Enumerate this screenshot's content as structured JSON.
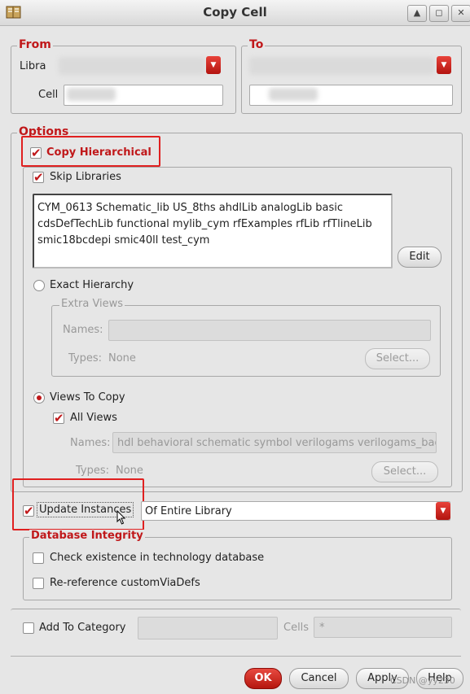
{
  "window": {
    "title": "Copy Cell"
  },
  "from": {
    "title": "From",
    "library_label": "Libra",
    "cell_label": "Cell"
  },
  "to": {
    "title": "To"
  },
  "options": {
    "title": "Options",
    "copy_hierarchical": {
      "label": "Copy Hierarchical",
      "checked": true
    },
    "skip_libraries": {
      "label": "Skip Libraries",
      "checked": true,
      "list": "CYM_0613 Schematic_lib US_8ths ahdlLib analogLib basic cdsDefTechLib functional mylib_cym rfExamples rfLib rfTlineLib smic18bcdepi smic40ll test_cym",
      "edit_label": "Edit"
    },
    "exact_hierarchy": {
      "label": "Exact Hierarchy",
      "selected": false,
      "extra_views_title": "Extra Views",
      "names_label": "Names:",
      "types_label": "Types:",
      "types_value": "None",
      "select_label": "Select..."
    },
    "views_to_copy": {
      "label": "Views To Copy",
      "selected": true,
      "all_views_label": "All Views",
      "names_label": "Names:",
      "names_value": "hdl behavioral schematic symbol verilogams verilogams_bad",
      "types_label": "Types:",
      "types_value": "None",
      "select_label": "Select..."
    }
  },
  "update_instances": {
    "label": "Update Instances",
    "checked": true,
    "scope": "Of Entire Library"
  },
  "database_integrity": {
    "title": "Database Integrity",
    "check_existence_label": "Check existence in technology database",
    "rereference_label": "Re-reference customViaDefs"
  },
  "category": {
    "label": "Add To Category",
    "cells_label": "Cells",
    "cells_value": "*"
  },
  "buttons": {
    "ok": "OK",
    "cancel": "Cancel",
    "apply": "Apply",
    "help": "Help"
  },
  "watermark": "CSDN @yy230",
  "colors": {
    "accent": "#c0181a",
    "highlight": "#e02020",
    "background": "#e6e6e6"
  },
  "icons": {
    "app": "book-icon",
    "arrow": "chevron-down-icon",
    "check": "checkmark-icon"
  }
}
